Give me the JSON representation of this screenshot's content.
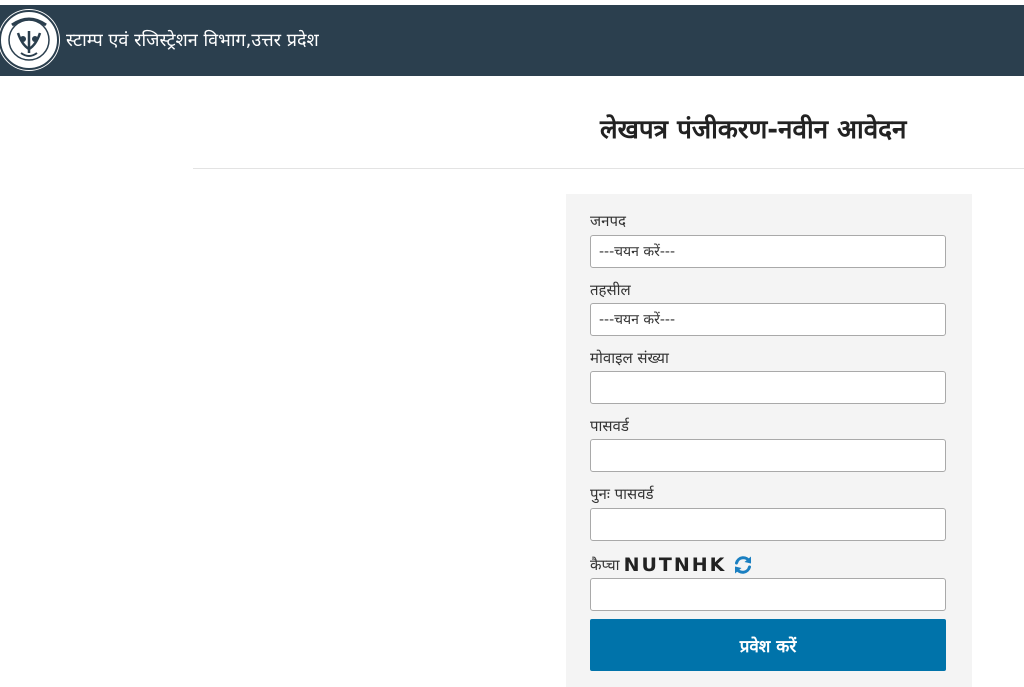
{
  "header": {
    "logo_icon": "uttar-pradesh-emblem-icon",
    "site_title": "स्टाम्प एवं रजिस्ट्रेशन विभाग,उत्तर प्रदेश",
    "background": "#2b3f4e"
  },
  "page": {
    "title": "लेखपत्र पंजीकरण-नवीन आवेदन"
  },
  "form": {
    "district": {
      "label": "जनपद",
      "selected": "---चयन करें---"
    },
    "tehsil": {
      "label": "तहसील",
      "selected": "---चयन करें---"
    },
    "mobile": {
      "label": "मोवाइल संख्या",
      "value": ""
    },
    "password": {
      "label": "पासवर्ड",
      "value": ""
    },
    "confirm_password": {
      "label": "पुनः पासवर्ड",
      "value": ""
    },
    "captcha": {
      "label": "कैप्चा",
      "code": "NUTNHK",
      "refresh_icon": "refresh-icon",
      "value": ""
    },
    "submit_label": "प्रवेश करें",
    "accent": "#0073aa"
  }
}
